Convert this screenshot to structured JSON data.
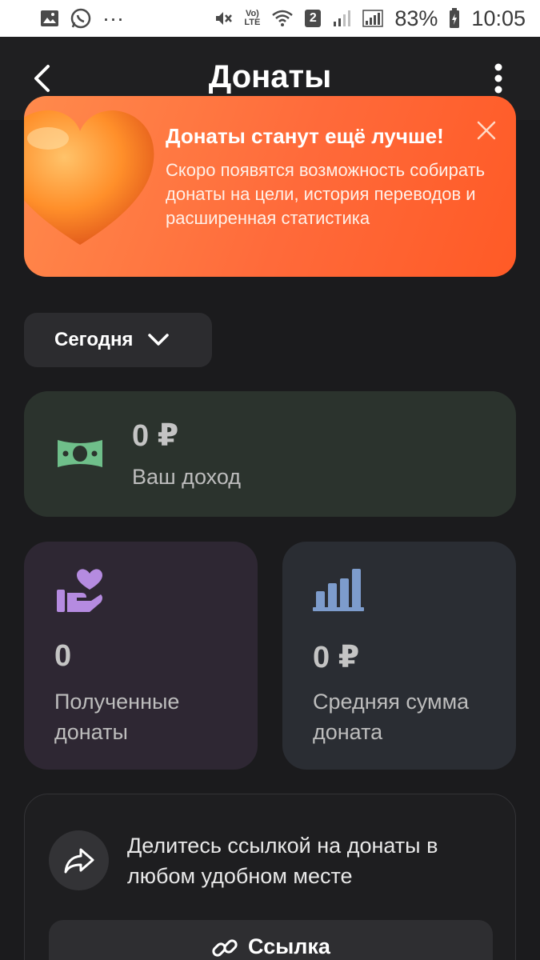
{
  "status_bar": {
    "battery": "83%",
    "time": "10:05",
    "sim_badge": "2",
    "dots": "···",
    "lte_top": "Vo)",
    "lte_bottom": "LTE"
  },
  "header": {
    "title": "Донаты"
  },
  "promo": {
    "title": "Донаты станут ещё лучше!",
    "text": "Скоро появятся возможность собирать донаты на цели, история переводов и расширенная статистика"
  },
  "period": {
    "selected": "Сегодня"
  },
  "income": {
    "value": "0 ₽",
    "label": "Ваш доход"
  },
  "stats": {
    "received": {
      "value": "0",
      "label": "Полученные донаты"
    },
    "average": {
      "value": "0 ₽",
      "label": "Средняя сумма доната"
    }
  },
  "share": {
    "text": "Делитесь ссылкой на донаты в любом удобном месте",
    "link_label": "Ссылка"
  },
  "colors": {
    "background": "#1b1b1d",
    "promo_orange": "#ff6a3a",
    "income_green": "#6fbf8a",
    "received_purple": "#b58be0",
    "average_blue": "#7d9ccc"
  }
}
